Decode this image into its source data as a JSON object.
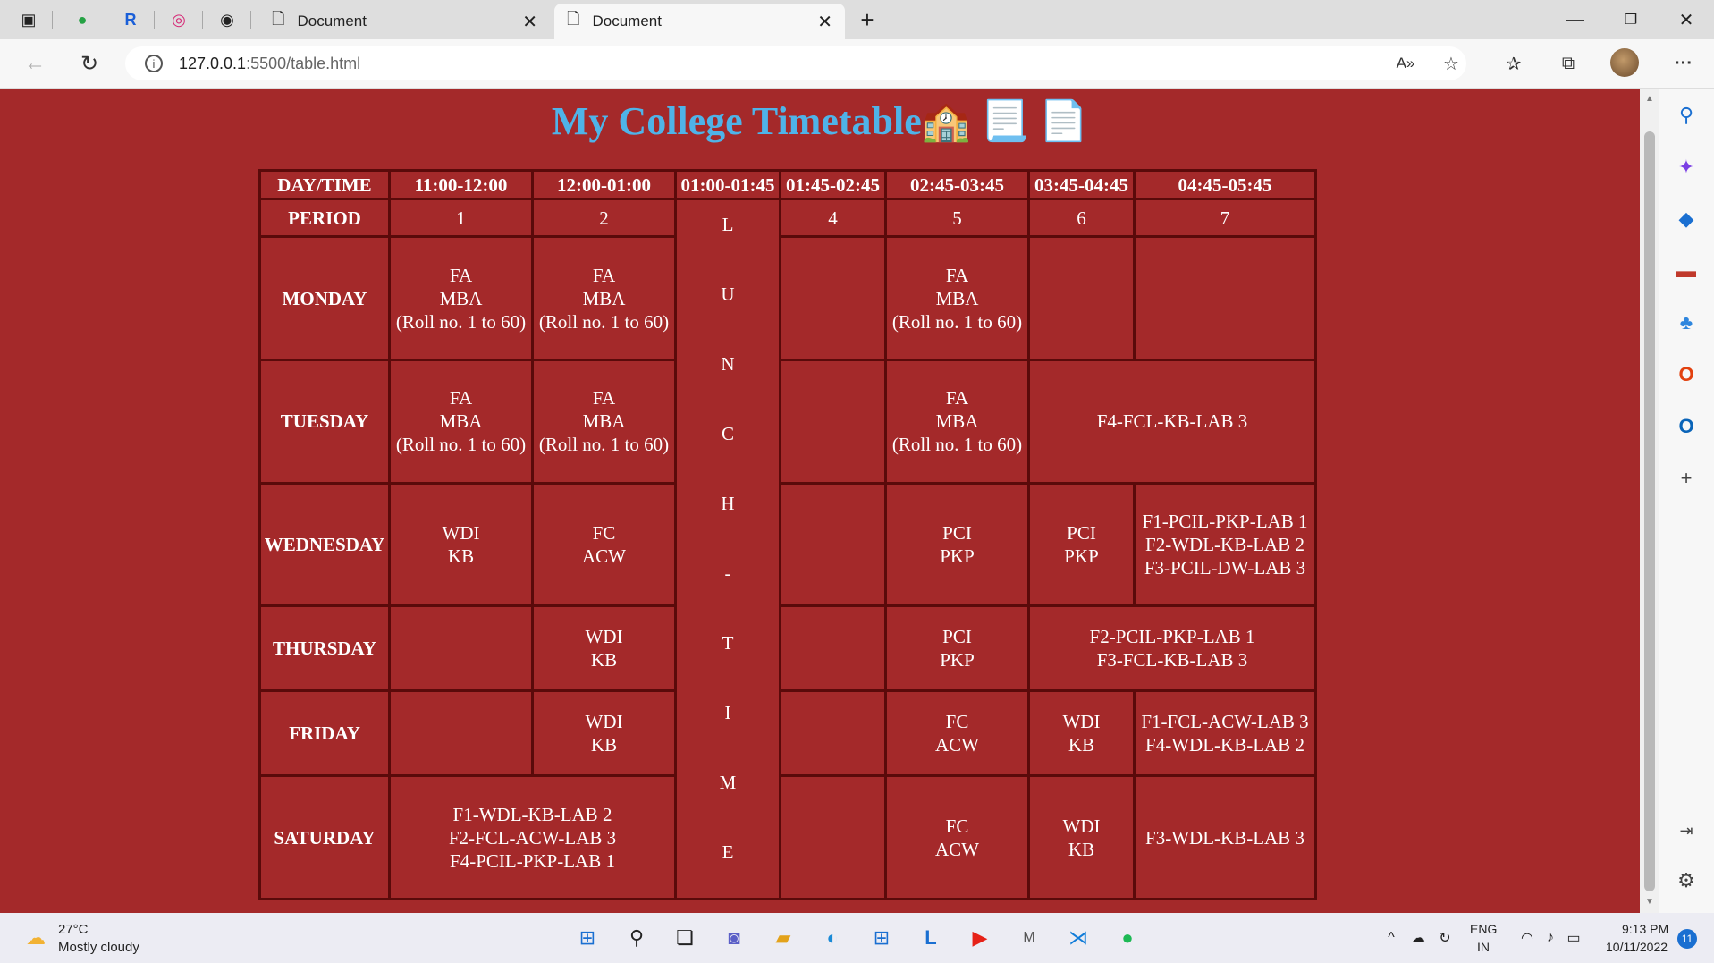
{
  "browser": {
    "tabs": [
      {
        "title": "Document",
        "active": false
      },
      {
        "title": "Document",
        "active": true
      }
    ],
    "url_host": "127.0.0.1",
    "url_rest": ":5500/table.html"
  },
  "page": {
    "title": "My College Timetable",
    "title_emojis": "🏫 📃 📄",
    "headers": [
      "DAY/TIME",
      "11:00-12:00",
      "12:00-01:00",
      "01:00-01:45",
      "01:45-02:45",
      "02:45-03:45",
      "03:45-04:45",
      "04:45-05:45"
    ],
    "period_label": "PERIOD",
    "periods": [
      "1",
      "2",
      "4",
      "5",
      "6",
      "7"
    ],
    "lunch_letters": [
      "L",
      "U",
      "N",
      "C",
      "H",
      "-",
      "T",
      "I",
      "M",
      "E"
    ],
    "days": [
      "MONDAY",
      "TUESDAY",
      "WEDNESDAY",
      "THURSDAY",
      "FRIDAY",
      "SATURDAY"
    ],
    "cells": {
      "mon_p1": [
        "FA",
        "MBA",
        "(Roll no. 1 to 60)"
      ],
      "mon_p2": [
        "FA",
        "MBA",
        "(Roll no. 1 to 60)"
      ],
      "mon_p5": [
        "FA",
        "MBA",
        "(Roll no. 1 to 60)"
      ],
      "tue_p1": [
        "FA",
        "MBA",
        "(Roll no. 1 to 60)"
      ],
      "tue_p2": [
        "FA",
        "MBA",
        "(Roll no. 1 to 60)"
      ],
      "tue_p5": [
        "FA",
        "MBA",
        "(Roll no. 1 to 60)"
      ],
      "tue_p67": [
        "F4-FCL-KB-LAB 3"
      ],
      "wed_p1": [
        "WDI",
        "KB"
      ],
      "wed_p2": [
        "FC",
        "ACW"
      ],
      "wed_p5": [
        "PCI",
        "PKP"
      ],
      "wed_p6": [
        "PCI",
        "PKP"
      ],
      "wed_p7": [
        "F1-PCIL-PKP-LAB 1",
        "F2-WDL-KB-LAB 2",
        "F3-PCIL-DW-LAB 3"
      ],
      "thu_p2": [
        "WDI",
        "KB"
      ],
      "thu_p5": [
        "PCI",
        "PKP"
      ],
      "thu_p67": [
        "F2-PCIL-PKP-LAB 1",
        "F3-FCL-KB-LAB 3"
      ],
      "fri_p2": [
        "WDI",
        "KB"
      ],
      "fri_p5": [
        "FC",
        "ACW"
      ],
      "fri_p6": [
        "WDI",
        "KB"
      ],
      "fri_p7": [
        "F1-FCL-ACW-LAB 3",
        "F4-WDL-KB-LAB 2"
      ],
      "sat_p12": [
        "F1-WDL-KB-LAB 2",
        "F2-FCL-ACW-LAB 3",
        "F4-PCIL-PKP-LAB 1"
      ],
      "sat_p5": [
        "FC",
        "ACW"
      ],
      "sat_p6": [
        "WDI",
        "KB"
      ],
      "sat_p7": [
        "F3-WDL-KB-LAB 3"
      ]
    }
  },
  "taskbar": {
    "temp": "27°C",
    "weather": "Mostly cloudy",
    "lang1": "ENG",
    "lang2": "IN",
    "time": "9:13 PM",
    "date": "10/11/2022",
    "notif_count": "11"
  },
  "colors": {
    "page_bg": "#a4292a",
    "title": "#4fb3e8",
    "border": "#5a0a0a"
  }
}
